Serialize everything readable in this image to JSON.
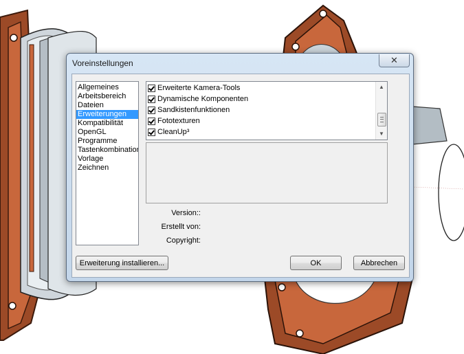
{
  "dialog": {
    "title": "Voreinstellungen",
    "close_icon": "close-icon",
    "categories": [
      "Allgemeines",
      "Arbeitsbereich",
      "Dateien",
      "Erweiterungen",
      "Kompatibilität",
      "OpenGL",
      "Programme",
      "Tastenkombination",
      "Vorlage",
      "Zeichnen"
    ],
    "selected_category": "Erweiterungen",
    "extensions": [
      {
        "label": "Erweiterte Kamera-Tools",
        "checked": true
      },
      {
        "label": "Dynamische Komponenten",
        "checked": true
      },
      {
        "label": "Sandkistenfunktionen",
        "checked": true
      },
      {
        "label": "Fototexturen",
        "checked": true
      },
      {
        "label": "CleanUp³",
        "checked": true
      }
    ],
    "info": {
      "version_label": "Version::",
      "created_label": "Erstellt von:",
      "copyright_label": "Copyright:"
    },
    "buttons": {
      "install": "Erweiterung installieren...",
      "ok": "OK",
      "cancel": "Abbrechen"
    }
  },
  "colors": {
    "selection": "#3399ff",
    "flange": "#a0502e",
    "cylinder": "#cfd6dc"
  }
}
